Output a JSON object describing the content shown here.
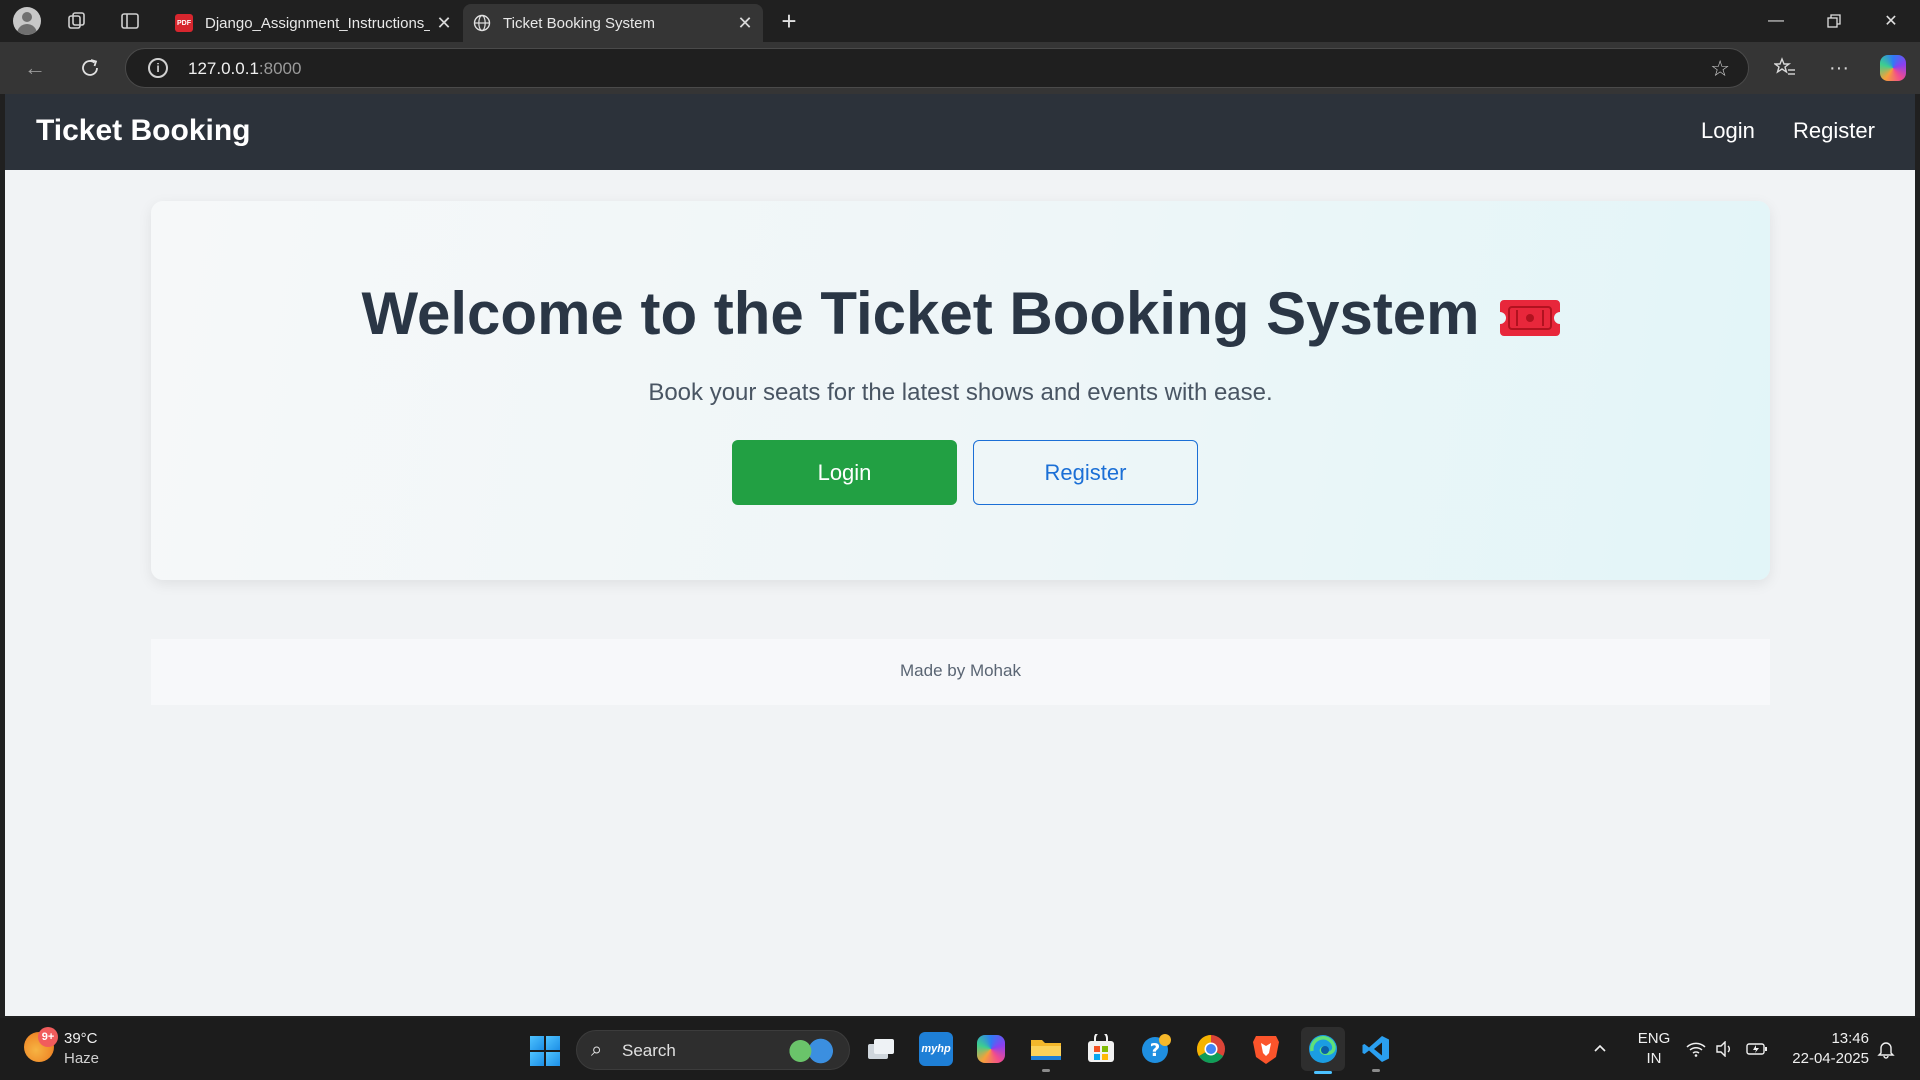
{
  "browser": {
    "tabs": [
      {
        "title": "Django_Assignment_Instructions_",
        "favicon": "pdf-icon",
        "active": false
      },
      {
        "title": "Ticket Booking System",
        "favicon": "globe-icon",
        "active": true
      }
    ],
    "url_host": "127.0.0.1",
    "url_port": ":8000"
  },
  "site": {
    "brand": "Ticket Booking",
    "nav": {
      "login": "Login",
      "register": "Register"
    },
    "hero": {
      "title": "Welcome to the Ticket Booking System",
      "title_icon": "ticket-icon",
      "subtitle": "Book your seats for the latest shows and events with ease.",
      "login_button": "Login",
      "register_button": "Register"
    },
    "footer": "Made by Mohak"
  },
  "colors": {
    "navbar": "#2c323a",
    "login_button": "#22a043",
    "register_button_border": "#1b6fd6",
    "title_text": "#2a3645",
    "ticket_icon": "#e8273b"
  },
  "taskbar": {
    "weather": {
      "temp": "39°C",
      "condition": "Haze",
      "badge": "9+"
    },
    "search_label": "Search",
    "language": {
      "line1": "ENG",
      "line2": "IN"
    },
    "clock": {
      "time": "13:46",
      "date": "22-04-2025"
    }
  }
}
